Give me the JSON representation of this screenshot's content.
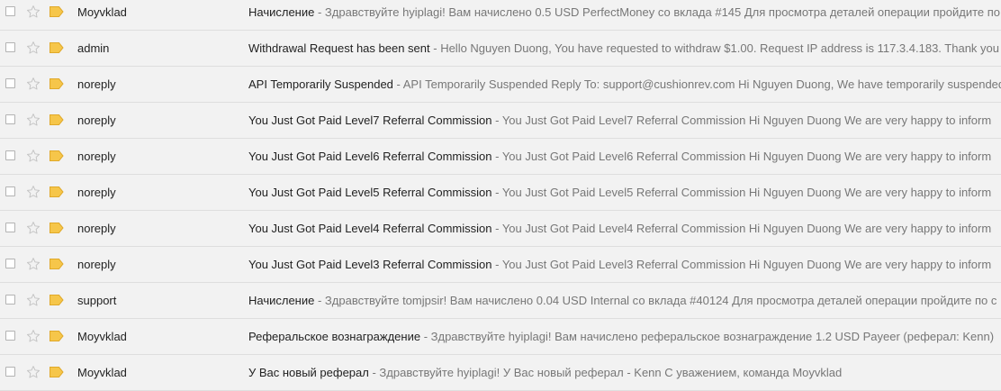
{
  "emails": [
    {
      "sender": "Moyvklad",
      "subject": "Начисление",
      "preview": "Здравствуйте hyiplagi! Вам начислено 0.5 USD PerfectMoney со вклада #145 Для просмотра деталей операции пройдите по"
    },
    {
      "sender": "admin",
      "subject": "Withdrawal Request has been sent",
      "preview": "Hello Nguyen Duong, You have requested to withdraw $1.00. Request IP address is 117.3.4.183. Thank you"
    },
    {
      "sender": "noreply",
      "subject": "API Temporarily Suspended",
      "preview": "API Temporarily Suspended Reply To: support@cushionrev.com Hi Nguyen Duong, We have temporarily suspended"
    },
    {
      "sender": "noreply",
      "subject": "You Just Got Paid Level7 Referral Commission",
      "preview": "You Just Got Paid Level7 Referral Commission Hi Nguyen Duong We are very happy to inform"
    },
    {
      "sender": "noreply",
      "subject": "You Just Got Paid Level6 Referral Commission",
      "preview": "You Just Got Paid Level6 Referral Commission Hi Nguyen Duong We are very happy to inform"
    },
    {
      "sender": "noreply",
      "subject": "You Just Got Paid Level5 Referral Commission",
      "preview": "You Just Got Paid Level5 Referral Commission Hi Nguyen Duong We are very happy to inform"
    },
    {
      "sender": "noreply",
      "subject": "You Just Got Paid Level4 Referral Commission",
      "preview": "You Just Got Paid Level4 Referral Commission Hi Nguyen Duong We are very happy to inform"
    },
    {
      "sender": "noreply",
      "subject": "You Just Got Paid Level3 Referral Commission",
      "preview": "You Just Got Paid Level3 Referral Commission Hi Nguyen Duong We are very happy to inform"
    },
    {
      "sender": "support",
      "subject": "Начисление",
      "preview": "Здравствуйте tomjpsir! Вам начислено 0.04 USD Internal со вклада #40124 Для просмотра деталей операции пройдите по с"
    },
    {
      "sender": "Moyvklad",
      "subject": "Реферальское вознаграждение",
      "preview": "Здравствуйте hyiplagi! Вам начислено реферальское вознаграждение 1.2 USD Payeer (реферал: Kenn)"
    },
    {
      "sender": "Moyvklad",
      "subject": "У Вас новый реферал",
      "preview": "Здравствуйте hyiplagi! У Вас новый реферал - Kenn С уважением, команда Moyvklad"
    }
  ],
  "separator": " - ",
  "colors": {
    "label_tag": "#f6c64a",
    "star_outline": "#c4c4c4",
    "row_border": "#dedede",
    "background": "#f2f2f2"
  }
}
